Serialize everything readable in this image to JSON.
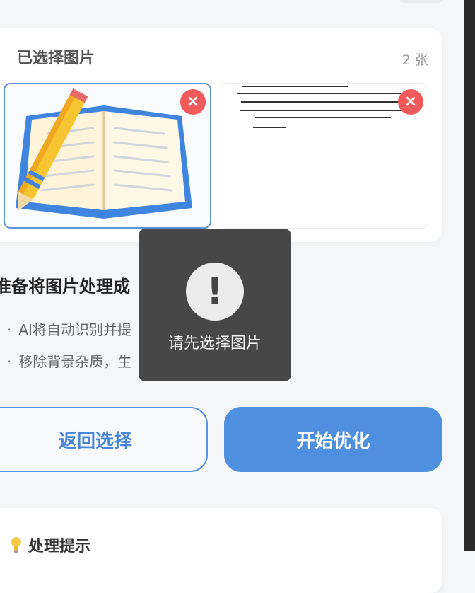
{
  "selected": {
    "title": "已选择图片",
    "count": "2 张",
    "remove_glyph": "×"
  },
  "process": {
    "heading": "准备将图片处理成",
    "bullets": [
      "AI将自动识别并提",
      "移除背景杂质，生"
    ]
  },
  "actions": {
    "back_label": "返回选择",
    "start_label": "开始优化"
  },
  "tips": {
    "title": "处理提示"
  },
  "toast": {
    "icon_glyph": "!",
    "message": "请先选择图片"
  },
  "colors": {
    "accent": "#4f8fe0",
    "remove": "#f05a5a",
    "toast_bg": "#404040"
  },
  "icons": [
    "close-icon",
    "lightbulb-icon",
    "exclamation-icon"
  ]
}
